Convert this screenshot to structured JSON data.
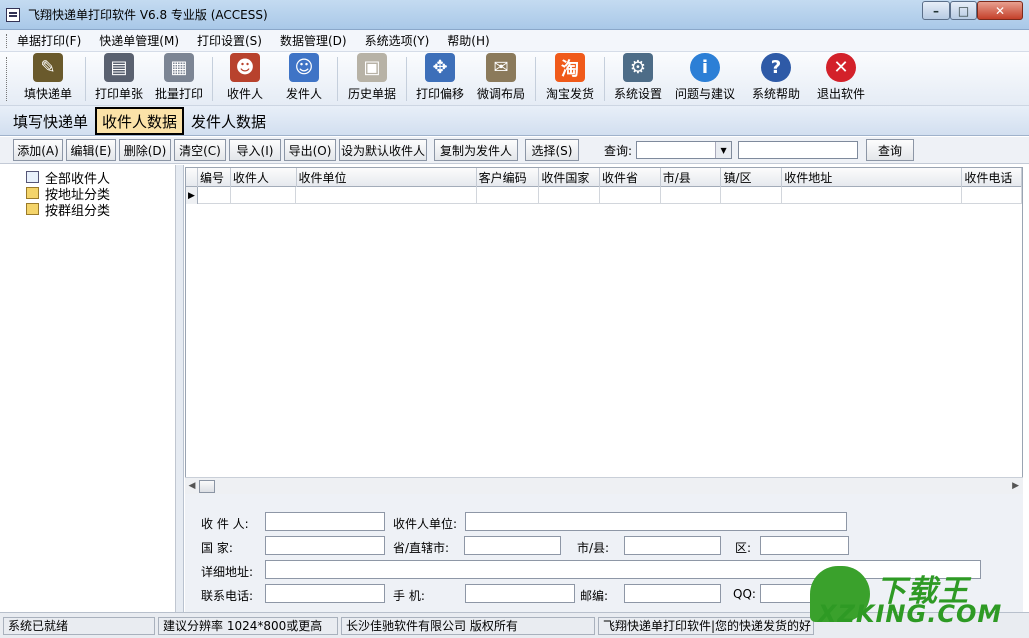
{
  "window": {
    "title": "飞翔快递单打印软件 V6.8 专业版 (ACCESS)",
    "min": "–",
    "max": "□",
    "close": "✕"
  },
  "menu": [
    "单据打印(F)",
    "快递单管理(M)",
    "打印设置(S)",
    "数据管理(D)",
    "系统选项(Y)",
    "帮助(H)"
  ],
  "toolbar": [
    {
      "label": "填快递单",
      "icon": "pen-icon",
      "color": "#6a5a2c",
      "glyph": "✎"
    },
    {
      "label": "打印单张",
      "icon": "printer-icon",
      "color": "#5a6170",
      "glyph": "▤"
    },
    {
      "label": "批量打印",
      "icon": "batch-printer-icon",
      "color": "#7c8594",
      "glyph": "▦"
    },
    {
      "label": "收件人",
      "icon": "recipient-people-icon",
      "color": "#b8422d",
      "glyph": "☻"
    },
    {
      "label": "发件人",
      "icon": "sender-people-icon",
      "color": "#3f74c6",
      "glyph": "☺"
    },
    {
      "label": "历史单据",
      "icon": "history-card-icon",
      "color": "#b7b2a6",
      "glyph": "▣"
    },
    {
      "label": "打印偏移",
      "icon": "offset-icon",
      "color": "#3d6fb9",
      "glyph": "✥"
    },
    {
      "label": "微调布局",
      "icon": "layout-tune-icon",
      "color": "#8b7a5b",
      "glyph": "✉"
    },
    {
      "label": "淘宝发货",
      "icon": "taobao-icon",
      "color": "#f05a1a",
      "glyph": "淘"
    },
    {
      "label": "系统设置",
      "icon": "settings-gear-icon",
      "color": "#4d6c87",
      "glyph": "⚙"
    },
    {
      "label": "问题与建议",
      "icon": "info-icon",
      "color": "#2c7fd6",
      "glyph": "i"
    },
    {
      "label": "系统帮助",
      "icon": "help-icon",
      "color": "#2e5aa7",
      "glyph": "?"
    },
    {
      "label": "退出软件",
      "icon": "exit-icon",
      "color": "#d3212a",
      "glyph": "✕"
    }
  ],
  "tabs": [
    "填写快递单",
    "收件人数据",
    "发件人数据"
  ],
  "actions": [
    "添加(A)",
    "编辑(E)",
    "删除(D)",
    "清空(C)",
    "导入(I)",
    "导出(O)",
    "设为默认收件人",
    "复制为发件人",
    "选择(S)"
  ],
  "query": {
    "label": "查询:",
    "button": "查询",
    "combo_value": "",
    "text_value": ""
  },
  "tree": [
    "全部收件人",
    "按地址分类",
    "按群组分类"
  ],
  "grid": {
    "columns": [
      "编号",
      "收件人",
      "收件单位",
      "客户编码",
      "收件国家",
      "收件省",
      "市/县",
      "镇/区",
      "收件地址",
      "收件电话"
    ]
  },
  "form": {
    "recipient": "收 件 人:",
    "company": "收件人单位:",
    "country": "国     家:",
    "province": "省/直辖市:",
    "city": "市/县:",
    "district": "区:",
    "address": "详细地址:",
    "phone": "联系电话:",
    "mobile": "手     机:",
    "zip": "邮编:",
    "qq": "QQ:"
  },
  "status": [
    "系统已就绪",
    "建议分辨率 1024*800或更高",
    "长沙佳驰软件有限公司 版权所有",
    "飞翔快递单打印软件|您的快递发货的好"
  ],
  "watermark": {
    "top": "下载王",
    "bottom": "XZKING.COM"
  }
}
